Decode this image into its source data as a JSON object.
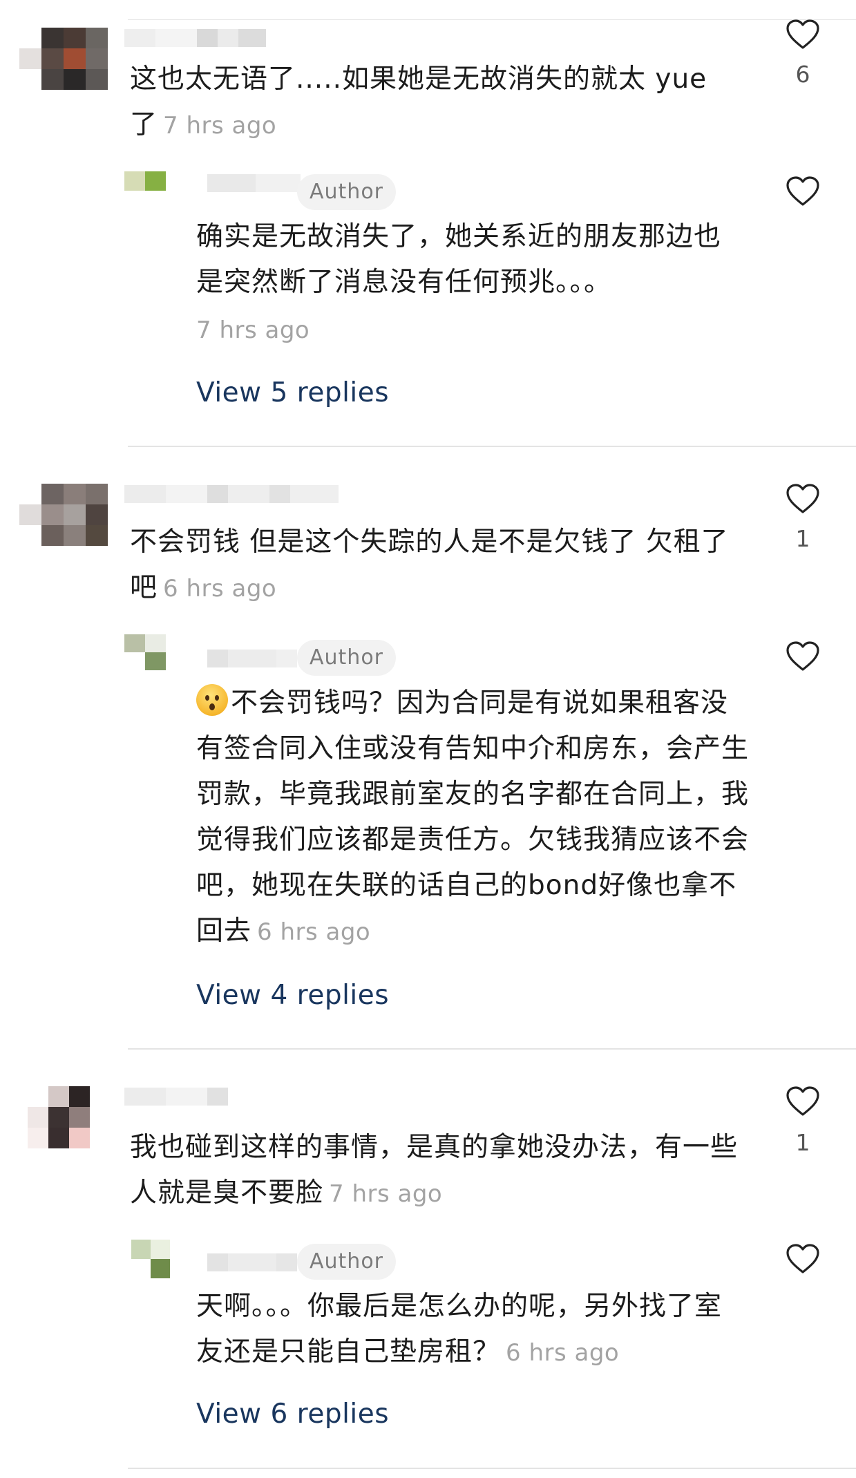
{
  "comments": [
    {
      "text": "这也太无语了.....如果她是无故消失的就太 yue 了",
      "time": "7 hrs ago",
      "likes": "6",
      "reply": {
        "badge": "Author",
        "text": "确实是无故消失了，她关系近的朋友那边也是突然断了消息没有任何预兆。。。",
        "time": "7 hrs ago"
      },
      "view_replies": "View 5 replies"
    },
    {
      "text": "不会罚钱 但是这个失踪的人是不是欠钱了 欠租了吧",
      "time": "6 hrs ago",
      "likes": "1",
      "reply": {
        "badge": "Author",
        "text": "不会罚钱吗？因为合同是有说如果租客没有签合同入住或没有告知中介和房东，会产生罚款，毕竟我跟前室友的名字都在合同上，我觉得我们应该都是责任方。欠钱我猜应该不会吧，她现在失联的话自己的bond好像也拿不回去",
        "emoji": "hushed-face-icon",
        "time": "6 hrs ago"
      },
      "view_replies": "View 4 replies"
    },
    {
      "text": "我也碰到这样的事情，是真的拿她没办法，有一些人就是臭不要脸",
      "time": "7 hrs ago",
      "likes": "1",
      "reply": {
        "badge": "Author",
        "text": "天啊。。。你最后是怎么办的呢，另外找了室友还是只能自己垫房租？",
        "time": "6 hrs ago"
      },
      "view_replies": "View 6 replies"
    }
  ],
  "icons": {
    "like": "heart-outline-icon"
  },
  "colors": {
    "link": "#19365e",
    "muted": "#a3a3a3",
    "badge_bg": "#f2f2f2"
  }
}
